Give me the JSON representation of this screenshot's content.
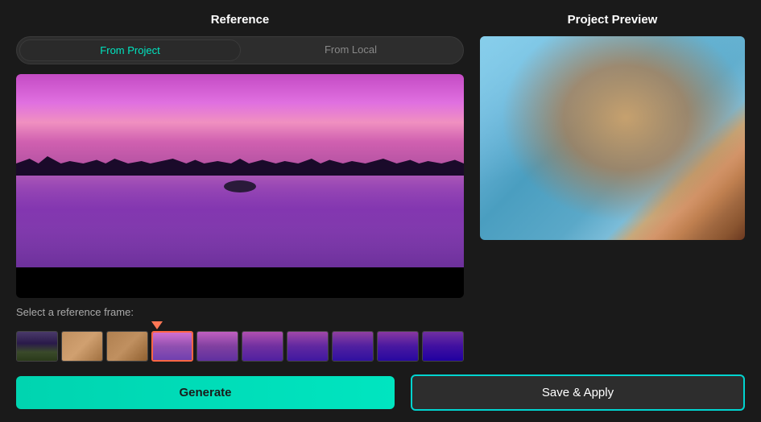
{
  "header": {
    "reference_title": "Reference",
    "preview_title": "Project Preview"
  },
  "tabs": {
    "from_project": "From Project",
    "from_local": "From Local"
  },
  "labels": {
    "select_reference": "Select a reference frame:",
    "generate": "Generate",
    "save_apply": "Save & Apply"
  },
  "filmstrip": {
    "thumbnail_count": 10,
    "selected_index": 3
  },
  "colors": {
    "accent": "#00e5c0",
    "save_border": "#00d4d0",
    "marker": "#ff7755",
    "bg": "#1a1a1a",
    "panel_bg": "#2d2d2d"
  }
}
